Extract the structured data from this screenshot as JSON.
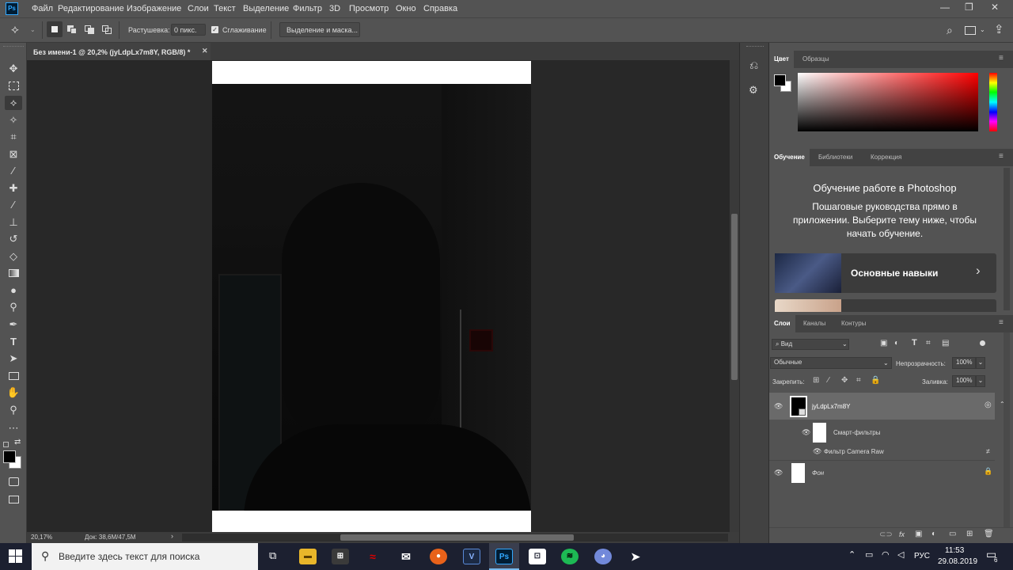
{
  "app": {
    "logo": "Ps"
  },
  "menu": [
    "Файл",
    "Редактирование",
    "Изображение",
    "Слои",
    "Текст",
    "Выделение",
    "Фильтр",
    "3D",
    "Просмотр",
    "Окно",
    "Справка"
  ],
  "options": {
    "feather_label": "Растушевка:",
    "feather_value": "0 пикс.",
    "antialias_label": "Сглаживание",
    "select_mask_label": "Выделение и маска..."
  },
  "document": {
    "tab_title": "Без имени-1 @ 20,2% (jyLdpLx7m8Y, RGB/8) *",
    "zoom": "20,17%",
    "doc_info": "Док: 38,6M/47,5M"
  },
  "color_panel": {
    "tabs": [
      "Цвет",
      "Образцы"
    ]
  },
  "learn_panel": {
    "tabs": [
      "Обучение",
      "Библиотеки",
      "Коррекция"
    ],
    "title": "Обучение работе в Photoshop",
    "description": "Пошаговые руководства прямо в приложении. Выберите тему ниже, чтобы начать обучение.",
    "card_label": "Основные навыки"
  },
  "layers_panel": {
    "tabs": [
      "Слои",
      "Каналы",
      "Контуры"
    ],
    "filter_kind": "Вид",
    "blend_mode": "Обычные",
    "opacity_label": "Непрозрачность:",
    "opacity_value": "100%",
    "lock_label": "Закрепить:",
    "fill_label": "Заливка:",
    "fill_value": "100%",
    "layers": {
      "main": "jyLdpLx7m8Y",
      "smart_filters": "Смарт-фильтры",
      "camera_raw": "Фильтр Camera Raw",
      "background": "Фон"
    }
  },
  "taskbar": {
    "search_placeholder": "Введите здесь текст для поиска",
    "language": "РУС",
    "time": "11:53",
    "date": "29.08.2019",
    "notifications": "6"
  },
  "colors": {
    "ps_blue": "#31a8ff",
    "ui_gray": "#535353",
    "canvas_dark": "#0c0c0c"
  }
}
